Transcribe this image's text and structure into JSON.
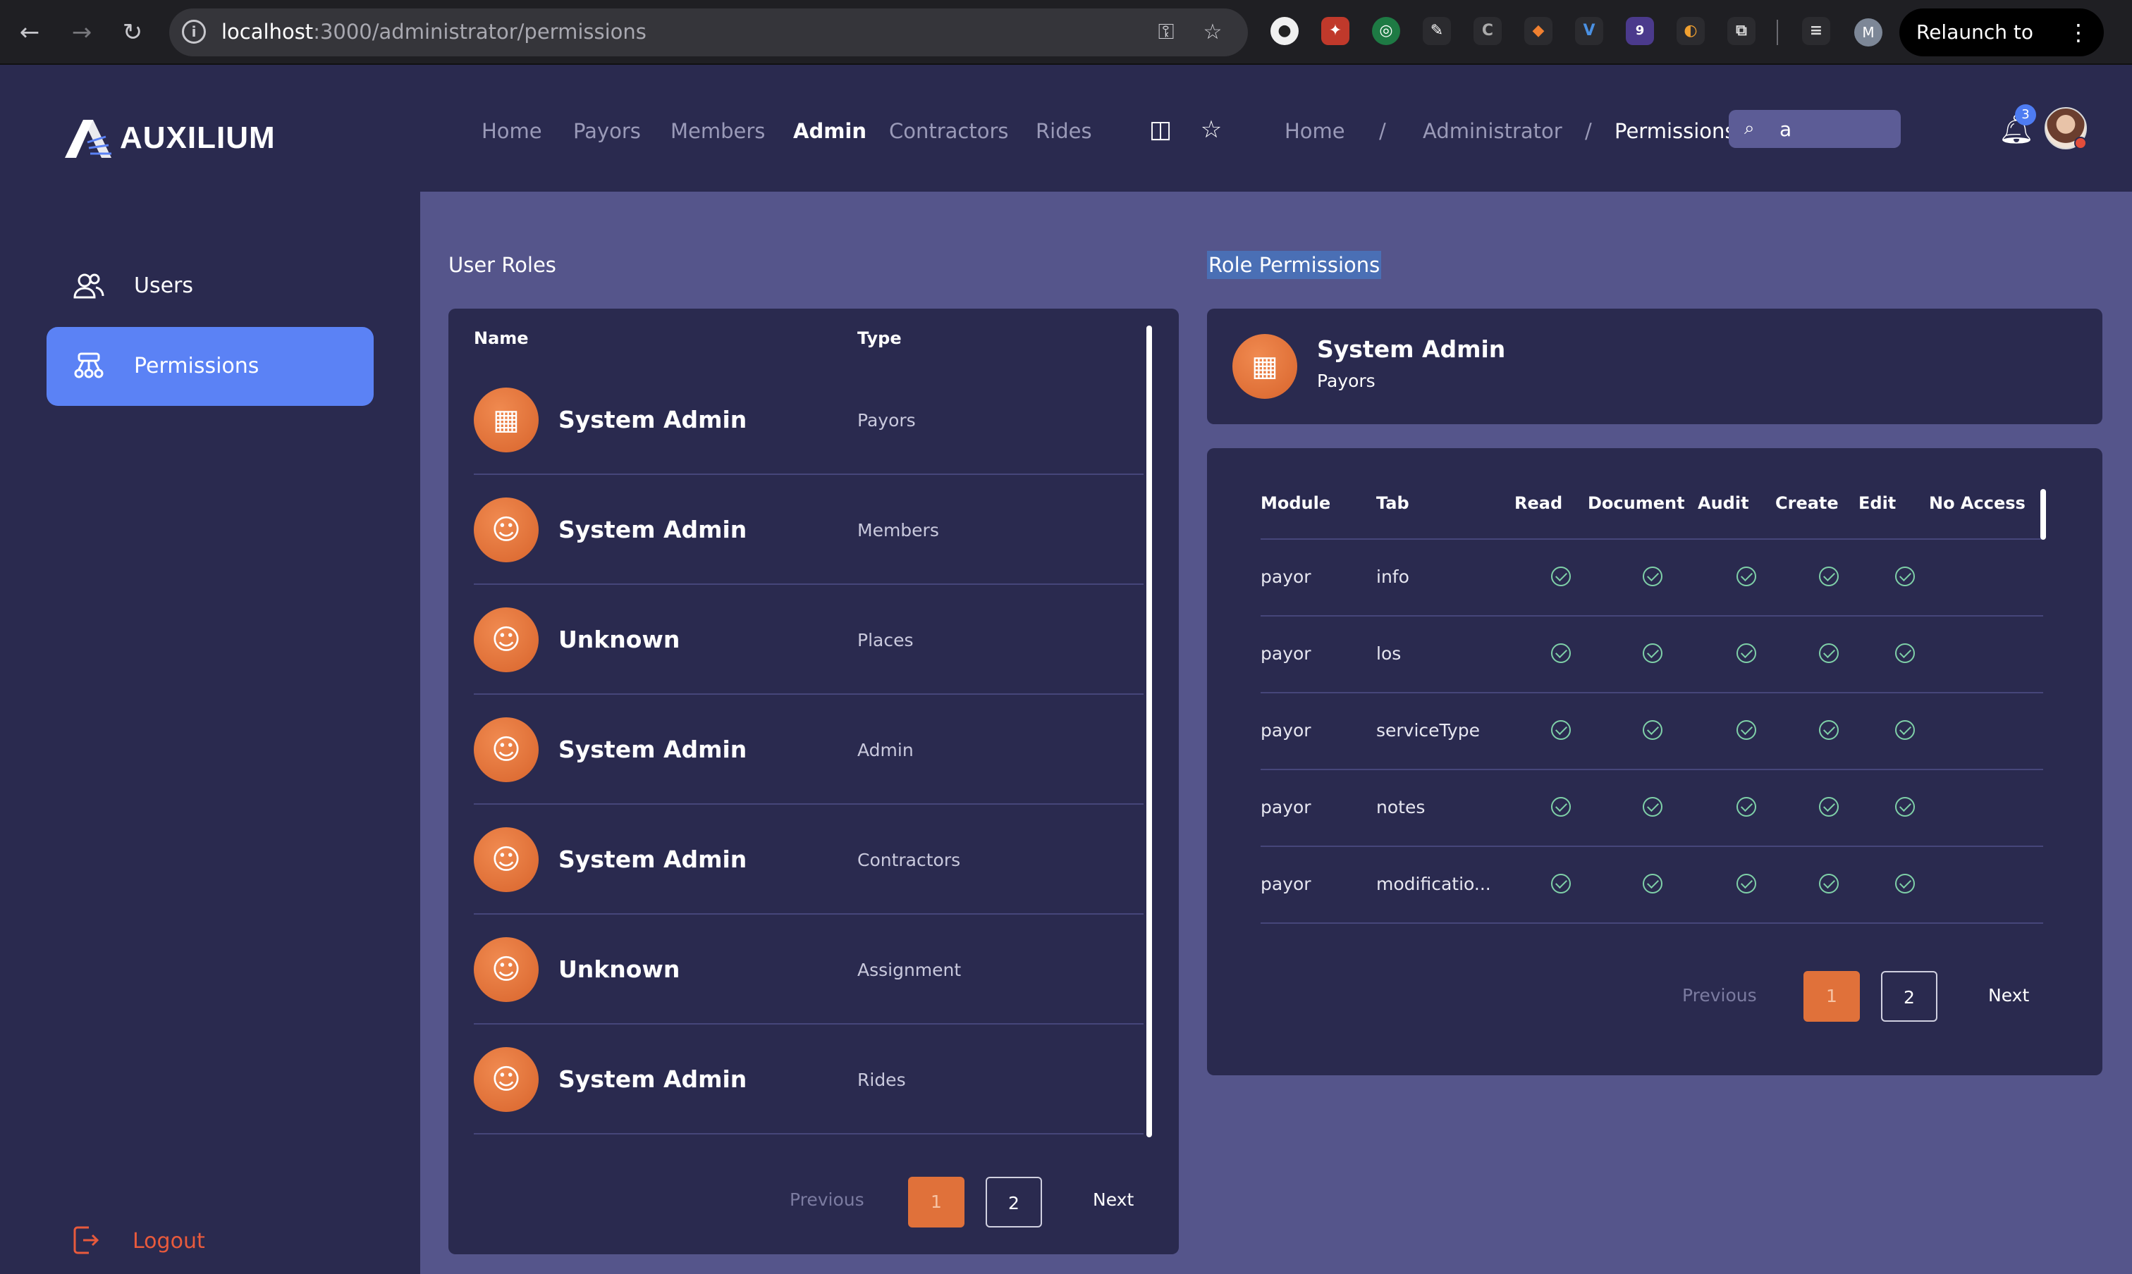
{
  "browser": {
    "url_host": "localhost",
    "url_path": ":3000/administrator/permissions",
    "relaunch_label": "Relaunch to update",
    "profile_initial": "M",
    "extension_badge": "9"
  },
  "app": {
    "logo_text": "AUXILIUM",
    "nav": [
      "Home",
      "Payors",
      "Members",
      "Admin",
      "Contractors",
      "Rides"
    ],
    "active_nav": "Admin",
    "breadcrumbs": [
      "Home",
      "Administrator",
      "Permissions"
    ],
    "breadcrumb_separator": "/",
    "search_value": "a",
    "notification_count": "3"
  },
  "sidebar": {
    "items": [
      {
        "label": "Users",
        "icon": "users-icon"
      },
      {
        "label": "Permissions",
        "icon": "permissions-icon"
      }
    ],
    "logout_label": "Logout"
  },
  "user_roles": {
    "title": "User Roles",
    "columns": [
      "Name",
      "Type"
    ],
    "rows": [
      {
        "name": "System Admin",
        "type": "Payors",
        "icon": "building-icon"
      },
      {
        "name": "System Admin",
        "type": "Members",
        "icon": "user-icon"
      },
      {
        "name": "Unknown",
        "type": "Places",
        "icon": "user-icon"
      },
      {
        "name": "System Admin",
        "type": "Admin",
        "icon": "user-icon"
      },
      {
        "name": "System Admin",
        "type": "Contractors",
        "icon": "user-icon"
      },
      {
        "name": "Unknown",
        "type": "Assignment",
        "icon": "user-icon"
      },
      {
        "name": "System Admin",
        "type": "Rides",
        "icon": "user-icon"
      }
    ],
    "pagination": {
      "previous": "Previous",
      "pages": [
        "1",
        "2"
      ],
      "current": "1",
      "next": "Next"
    }
  },
  "role_permissions": {
    "title": "Role Permissions",
    "selected_role": {
      "name": "System Admin",
      "type": "Payors",
      "icon": "building-icon"
    },
    "columns": [
      "Module",
      "Tab",
      "Read",
      "Document",
      "Audit",
      "Create",
      "Edit",
      "No Access"
    ],
    "rows": [
      {
        "module": "payor",
        "tab": "info",
        "read": true,
        "document": true,
        "audit": true,
        "create": true,
        "edit": true,
        "no_access": false
      },
      {
        "module": "payor",
        "tab": "los",
        "read": true,
        "document": true,
        "audit": true,
        "create": true,
        "edit": true,
        "no_access": false
      },
      {
        "module": "payor",
        "tab": "serviceType",
        "read": true,
        "document": true,
        "audit": true,
        "create": true,
        "edit": true,
        "no_access": false
      },
      {
        "module": "payor",
        "tab": "notes",
        "read": true,
        "document": true,
        "audit": true,
        "create": true,
        "edit": true,
        "no_access": false
      },
      {
        "module": "payor",
        "tab": "modificatio...",
        "read": true,
        "document": true,
        "audit": true,
        "create": true,
        "edit": true,
        "no_access": false
      }
    ],
    "pagination": {
      "previous": "Previous",
      "pages": [
        "1",
        "2"
      ],
      "current": "1",
      "next": "Next"
    }
  },
  "colors": {
    "sidebar_bg": "#2a2a4f",
    "main_bg": "#55558b",
    "accent_blue": "#5b82f5",
    "accent_orange": "#e0713a",
    "check_green": "#7fd0a8",
    "logout_red": "#e85a3c"
  }
}
